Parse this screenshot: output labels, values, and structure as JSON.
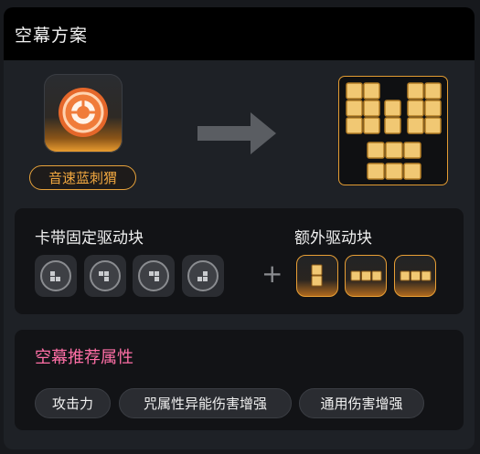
{
  "header": {
    "title": "空幕方案"
  },
  "character": {
    "name": "音速蓝刺猬",
    "icon": "orange-disc-icon"
  },
  "drivers": {
    "fixed_title": "卡带固定驱动块",
    "extra_title": "额外驱动块",
    "fixed_count": 4,
    "extra_count": 3,
    "plus": "+"
  },
  "attributes": {
    "title": "空幕推荐属性",
    "chips": [
      "攻击力",
      "咒属性异能伤害增强",
      "通用伤害增强"
    ]
  },
  "colors": {
    "accent": "#e89f35",
    "attr_title": "#ff6fa6",
    "tile": "#f1c873"
  }
}
